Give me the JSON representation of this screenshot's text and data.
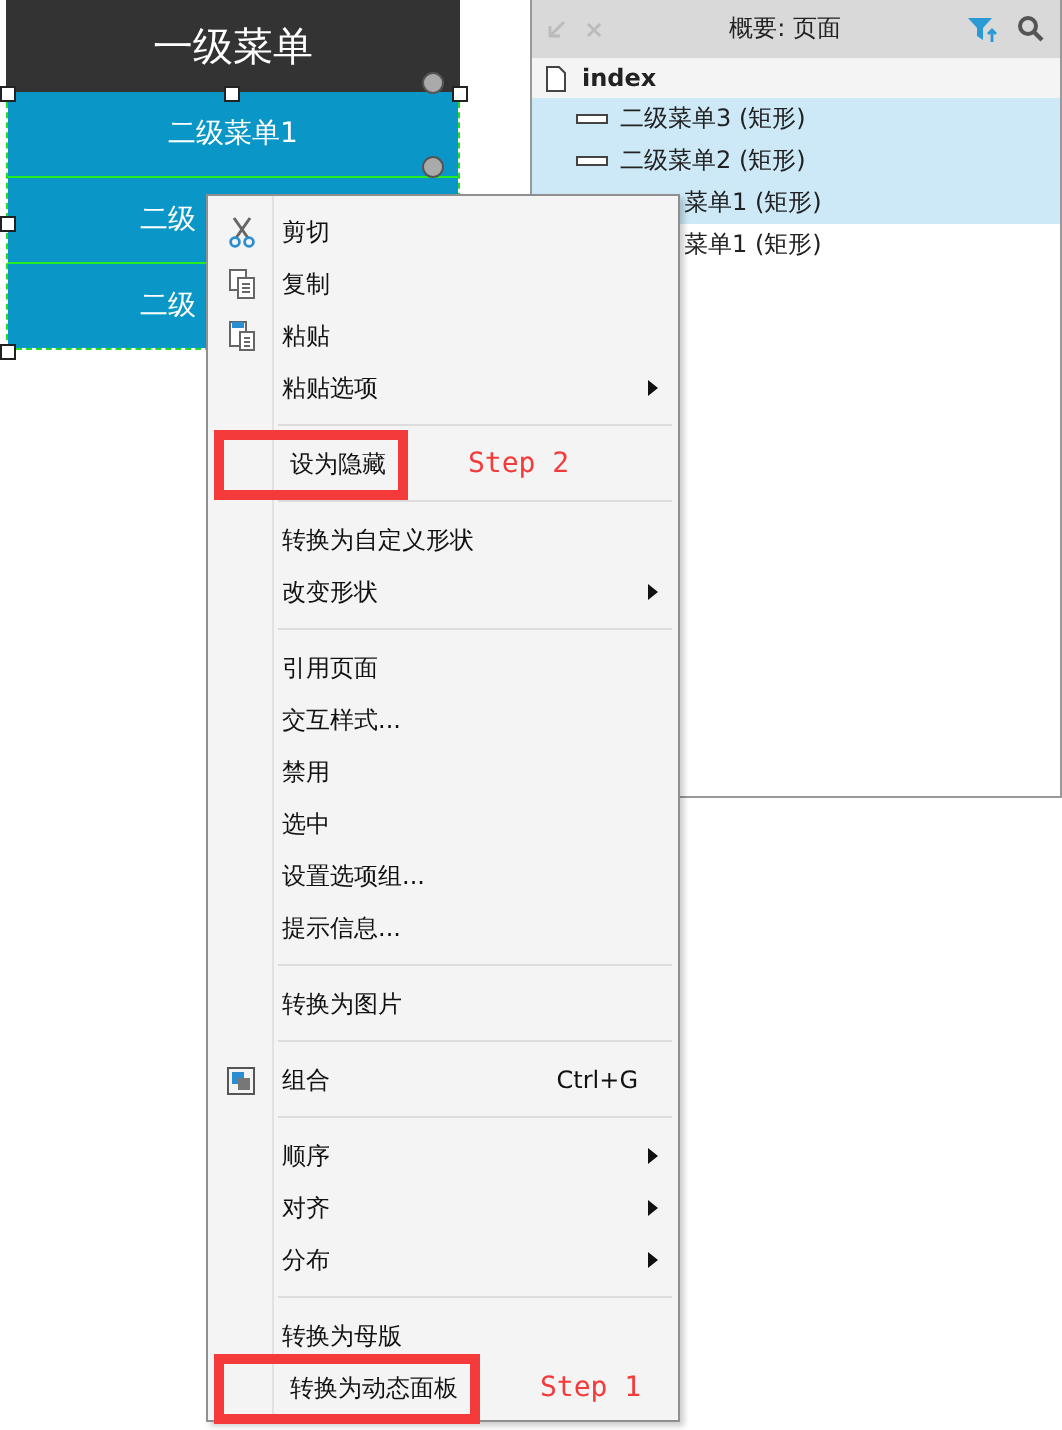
{
  "canvas": {
    "header": "一级菜单",
    "rows": [
      {
        "label": "二级菜单1",
        "partial": false
      },
      {
        "label": "二级",
        "partial": true
      },
      {
        "label": "二级",
        "partial": true
      }
    ]
  },
  "outline_panel": {
    "title": "概要: 页面",
    "page": "index",
    "rows": [
      {
        "label": "二级菜单3 (矩形)",
        "selected": true,
        "partial": false
      },
      {
        "label": "二级菜单2 (矩形)",
        "selected": true,
        "partial": false
      },
      {
        "label": "菜单1 (矩形)",
        "selected": true,
        "partial": true
      },
      {
        "label": "菜单1 (矩形)",
        "selected": false,
        "partial": true
      }
    ]
  },
  "context_menu": {
    "items": [
      {
        "kind": "item",
        "label": "剪切"
      },
      {
        "kind": "item",
        "label": "复制"
      },
      {
        "kind": "item",
        "label": "粘贴"
      },
      {
        "kind": "submenu",
        "label": "粘贴选项"
      },
      {
        "kind": "separator"
      },
      {
        "kind": "item",
        "label": "设为隐藏",
        "step": "Step 2"
      },
      {
        "kind": "separator"
      },
      {
        "kind": "item",
        "label": "转换为自定义形状"
      },
      {
        "kind": "submenu",
        "label": "改变形状"
      },
      {
        "kind": "separator"
      },
      {
        "kind": "item",
        "label": "引用页面"
      },
      {
        "kind": "item",
        "label": "交互样式..."
      },
      {
        "kind": "item",
        "label": "禁用"
      },
      {
        "kind": "item",
        "label": "选中"
      },
      {
        "kind": "item",
        "label": "设置选项组..."
      },
      {
        "kind": "item",
        "label": "提示信息..."
      },
      {
        "kind": "separator"
      },
      {
        "kind": "item",
        "label": "转换为图片"
      },
      {
        "kind": "separator"
      },
      {
        "kind": "item",
        "label": "组合",
        "shortcut": "Ctrl+G"
      },
      {
        "kind": "separator"
      },
      {
        "kind": "submenu",
        "label": "顺序"
      },
      {
        "kind": "submenu",
        "label": "对齐"
      },
      {
        "kind": "submenu",
        "label": "分布"
      },
      {
        "kind": "separator"
      },
      {
        "kind": "item",
        "label": "转换为母版"
      },
      {
        "kind": "item",
        "label": "转换为动态面板",
        "step": "Step 1"
      }
    ]
  }
}
